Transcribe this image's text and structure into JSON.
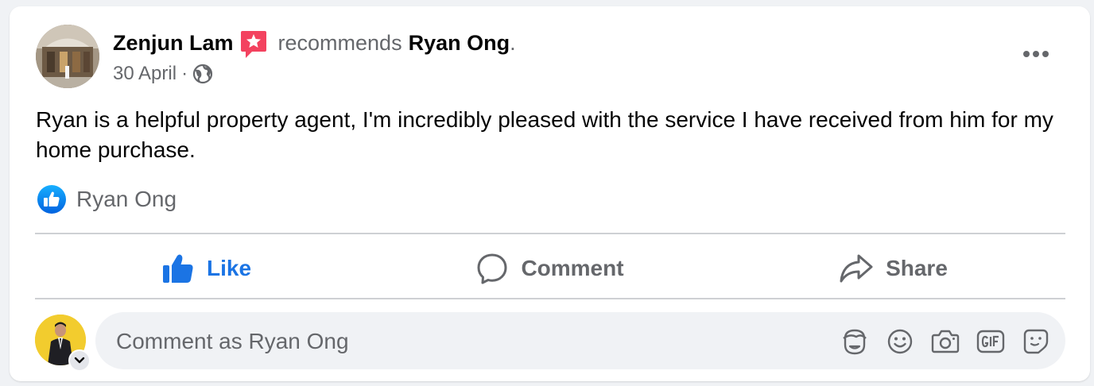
{
  "post": {
    "author": "Zenjun Lam",
    "action_text": "recommends",
    "target": "Ryan Ong",
    "period": ".",
    "date": "30 April",
    "separator": "·",
    "privacy_icon": "globe-icon",
    "text": "Ryan is a helpful property agent, I'm incredibly pleased with the service I have received from him for my home purchase."
  },
  "reactions": {
    "icon": "like-icon",
    "names": "Ryan Ong"
  },
  "actions": {
    "like": "Like",
    "comment": "Comment",
    "share": "Share"
  },
  "comment_box": {
    "placeholder": "Comment as Ryan Ong",
    "tools": [
      "avatar-sticker-icon",
      "emoji-icon",
      "camera-icon",
      "gif-icon",
      "sticker-icon"
    ]
  },
  "colors": {
    "like_blue": "#1b74e4",
    "secondary_text": "#65676b",
    "recommend_badge": "#f3425f",
    "me_avatar_bg": "#f2cc2e"
  }
}
